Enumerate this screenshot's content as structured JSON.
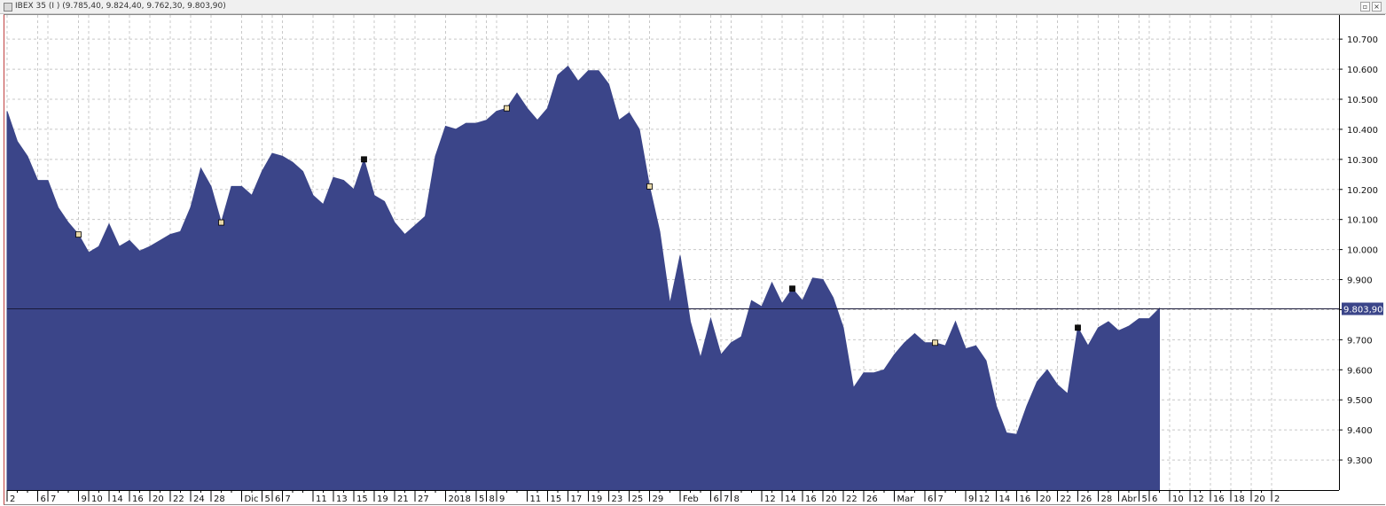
{
  "window": {
    "title": "IBEX 35 (I ) (9.785,40, 9.824,40, 9.762,30, 9.803,90)",
    "restore_glyph": "▫",
    "close_glyph": "×",
    "system_icon": "window-icon"
  },
  "colors": {
    "area_fill": "#3b4589",
    "grid": "#c8c8c8",
    "last_value_label_bg": "#3b4589",
    "marker_dark": "#111111",
    "marker_light": "#e8d8a8"
  },
  "chart_data": {
    "type": "area",
    "title": "IBEX 35 (I )",
    "ylim": [
      9200,
      10780
    ],
    "grid": true,
    "y_ticks": [
      {
        "value": 10700,
        "label": "10.700"
      },
      {
        "value": 10600,
        "label": "10.600"
      },
      {
        "value": 10500,
        "label": "10.500"
      },
      {
        "value": 10400,
        "label": "10.400"
      },
      {
        "value": 10300,
        "label": "10.300"
      },
      {
        "value": 10200,
        "label": "10.200"
      },
      {
        "value": 10100,
        "label": "10.100"
      },
      {
        "value": 10000,
        "label": "10.000"
      },
      {
        "value": 9900,
        "label": "9.900"
      },
      {
        "value": 9800,
        "label": "9.800"
      },
      {
        "value": 9700,
        "label": "9.700"
      },
      {
        "value": 9600,
        "label": "9.600"
      },
      {
        "value": 9500,
        "label": "9.500"
      },
      {
        "value": 9400,
        "label": "9.400"
      },
      {
        "value": 9300,
        "label": "9.300"
      }
    ],
    "x_tick_labels": [
      {
        "index": 0,
        "label": "2"
      },
      {
        "index": 3,
        "label": "6"
      },
      {
        "index": 4,
        "label": "7"
      },
      {
        "index": 7,
        "label": "9"
      },
      {
        "index": 8,
        "label": "10"
      },
      {
        "index": 10,
        "label": "14"
      },
      {
        "index": 12,
        "label": "16"
      },
      {
        "index": 14,
        "label": "20"
      },
      {
        "index": 16,
        "label": "22"
      },
      {
        "index": 18,
        "label": "24"
      },
      {
        "index": 20,
        "label": "28"
      },
      {
        "index": 23,
        "label": "Dic"
      },
      {
        "index": 25,
        "label": "5"
      },
      {
        "index": 26,
        "label": "6"
      },
      {
        "index": 27,
        "label": "7"
      },
      {
        "index": 30,
        "label": "11"
      },
      {
        "index": 32,
        "label": "13"
      },
      {
        "index": 34,
        "label": "15"
      },
      {
        "index": 36,
        "label": "19"
      },
      {
        "index": 38,
        "label": "21"
      },
      {
        "index": 40,
        "label": "27"
      },
      {
        "index": 43,
        "label": "2018"
      },
      {
        "index": 46,
        "label": "5"
      },
      {
        "index": 47,
        "label": "8"
      },
      {
        "index": 48,
        "label": "9"
      },
      {
        "index": 51,
        "label": "11"
      },
      {
        "index": 53,
        "label": "15"
      },
      {
        "index": 55,
        "label": "17"
      },
      {
        "index": 57,
        "label": "19"
      },
      {
        "index": 59,
        "label": "23"
      },
      {
        "index": 61,
        "label": "25"
      },
      {
        "index": 63,
        "label": "29"
      },
      {
        "index": 66,
        "label": "Feb"
      },
      {
        "index": 69,
        "label": "6"
      },
      {
        "index": 70,
        "label": "7"
      },
      {
        "index": 71,
        "label": "8"
      },
      {
        "index": 74,
        "label": "12"
      },
      {
        "index": 76,
        "label": "14"
      },
      {
        "index": 78,
        "label": "16"
      },
      {
        "index": 80,
        "label": "20"
      },
      {
        "index": 82,
        "label": "22"
      },
      {
        "index": 84,
        "label": "26"
      },
      {
        "index": 87,
        "label": "Mar"
      },
      {
        "index": 90,
        "label": "6"
      },
      {
        "index": 91,
        "label": "7"
      },
      {
        "index": 94,
        "label": "9"
      },
      {
        "index": 95,
        "label": "12"
      },
      {
        "index": 97,
        "label": "14"
      },
      {
        "index": 99,
        "label": "16"
      },
      {
        "index": 101,
        "label": "20"
      },
      {
        "index": 103,
        "label": "22"
      },
      {
        "index": 105,
        "label": "26"
      },
      {
        "index": 107,
        "label": "28"
      },
      {
        "index": 109,
        "label": "Abr"
      },
      {
        "index": 111,
        "label": "5"
      },
      {
        "index": 112,
        "label": "6"
      },
      {
        "index": 114,
        "label": "10"
      },
      {
        "index": 116,
        "label": "12"
      },
      {
        "index": 118,
        "label": "16"
      },
      {
        "index": 120,
        "label": "18"
      },
      {
        "index": 122,
        "label": "20"
      },
      {
        "index": 124,
        "label": "2"
      }
    ],
    "values": [
      10460,
      10360,
      10310,
      10230,
      10230,
      10140,
      10090,
      10050,
      9990,
      10010,
      10085,
      10010,
      10030,
      9995,
      10010,
      10030,
      10050,
      10060,
      10140,
      10270,
      10210,
      10090,
      10210,
      10210,
      10180,
      10260,
      10320,
      10310,
      10290,
      10260,
      10180,
      10150,
      10240,
      10230,
      10200,
      10300,
      10180,
      10160,
      10090,
      10050,
      10080,
      10110,
      10310,
      10410,
      10400,
      10420,
      10420,
      10430,
      10460,
      10470,
      10520,
      10470,
      10430,
      10470,
      10580,
      10610,
      10560,
      10595,
      10595,
      10550,
      10430,
      10455,
      10400,
      10210,
      10060,
      9820,
      9980,
      9760,
      9640,
      9770,
      9650,
      9690,
      9710,
      9830,
      9810,
      9890,
      9820,
      9870,
      9830,
      9905,
      9900,
      9840,
      9740,
      9540,
      9590,
      9590,
      9600,
      9650,
      9690,
      9720,
      9690,
      9690,
      9680,
      9760,
      9670,
      9680,
      9630,
      9480,
      9390,
      9385,
      9480,
      9560,
      9600,
      9550,
      9520,
      9740,
      9680,
      9740,
      9760,
      9730,
      9745,
      9770,
      9770,
      9803.9
    ],
    "markers": [
      {
        "index": 7,
        "kind": "light"
      },
      {
        "index": 21,
        "kind": "light"
      },
      {
        "index": 35,
        "kind": "dark"
      },
      {
        "index": 49,
        "kind": "light"
      },
      {
        "index": 63,
        "kind": "light"
      },
      {
        "index": 77,
        "kind": "dark"
      },
      {
        "index": 91,
        "kind": "light"
      },
      {
        "index": 105,
        "kind": "dark"
      }
    ],
    "last_value": 9803.9,
    "last_value_label": "9.803,90",
    "x_slot_count": 125
  }
}
